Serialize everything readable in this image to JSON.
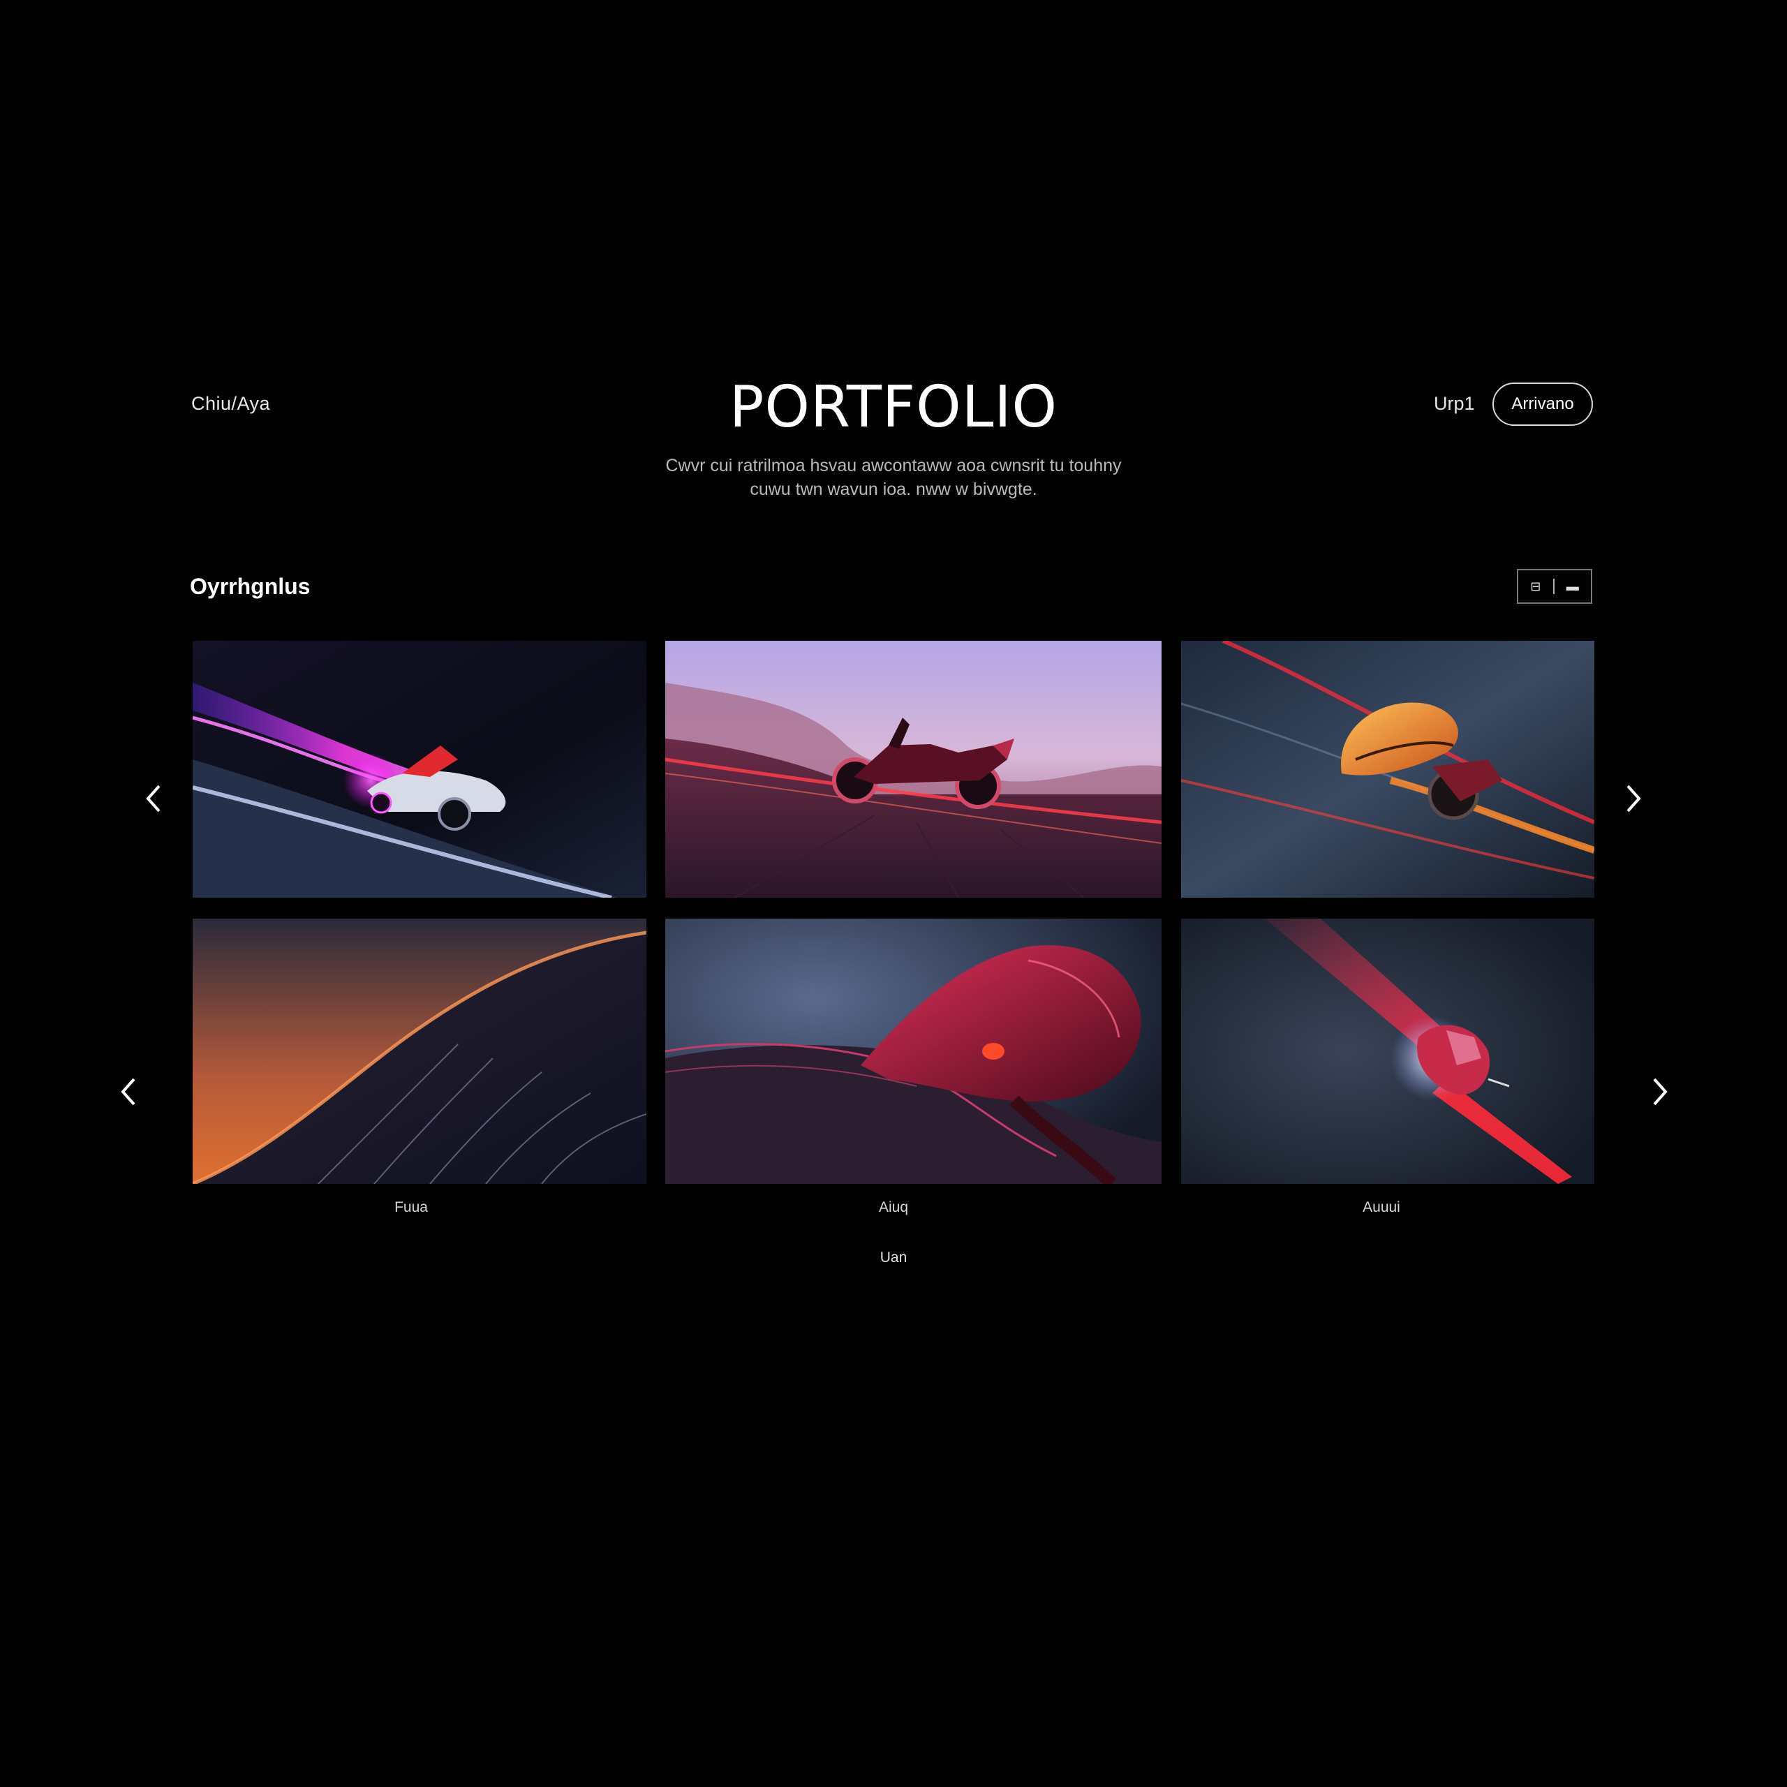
{
  "header": {
    "brand": "Chiu/Aya",
    "title": "PORTFOLIO",
    "nav_link": "Urp1",
    "nav_button": "Arrivano"
  },
  "subtitle": {
    "line1": "Cwvr cui ratrilmoa hsvau awcontaww aoa cwnsrit tu touhny",
    "line2": "cuwu twn wavun ioa. nww w bivwgte."
  },
  "section": {
    "heading": "Oyrrhgnlus",
    "toggle": {
      "left": "⊟",
      "right": "▬"
    }
  },
  "gallery": {
    "items": [
      {
        "name": "purple-streak-car",
        "icon": "image"
      },
      {
        "name": "motorcycle-desert-dusk",
        "icon": "image"
      },
      {
        "name": "orange-helmet-rider",
        "icon": "image"
      },
      {
        "name": "orange-horizon-waves",
        "icon": "image"
      },
      {
        "name": "crimson-sculpture",
        "icon": "image"
      },
      {
        "name": "red-beam-rider",
        "icon": "image"
      }
    ],
    "captions": [
      "Fuua",
      "Aiuq",
      "Auuui"
    ]
  },
  "footer": {
    "label": "Uan"
  },
  "colors": {
    "background": "#000000",
    "text": "#ffffff",
    "muted": "#b9b9b9",
    "accent_magenta": "#d93cff",
    "accent_red": "#ff2a3c",
    "accent_orange": "#ff8a2a"
  }
}
